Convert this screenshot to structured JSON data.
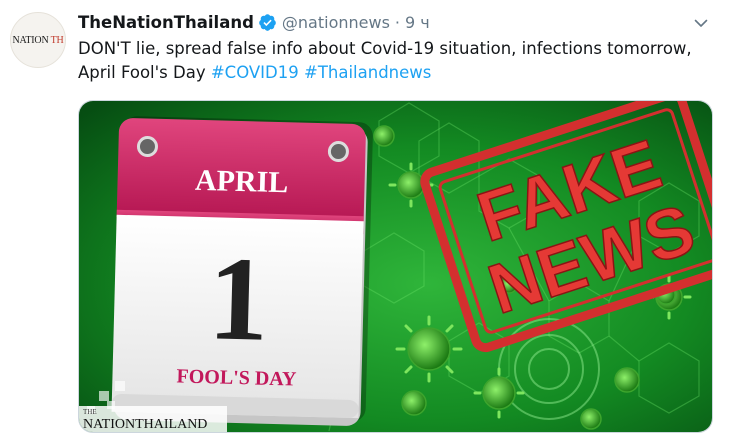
{
  "tweet": {
    "avatar": {
      "brand_main": "NATION",
      "brand_accent": "TH"
    },
    "author": {
      "display_name": "TheNationThailand",
      "handle": "@nationnews",
      "separator": "·",
      "time": "9 ч"
    },
    "text": {
      "body": "DON'T lie, spread false info about Covid-19 situation, infections tomorrow, April Fool's Day",
      "hashtags": [
        "#COVID19",
        "#Thailandnews"
      ]
    },
    "media": {
      "calendar_month": "APRIL",
      "calendar_day": "1",
      "calendar_caption": "FOOL'S DAY",
      "stamp_line1": "FAKE",
      "stamp_line2": "NEWS",
      "watermark_small": "THE",
      "watermark": "NATIONTHAILAND"
    }
  },
  "colors": {
    "link": "#1da1f2",
    "verified": "#1da1f2",
    "stamp_red": "#d32f2f",
    "calendar_magenta": "#c2185b",
    "background_green": "#0f7a1e"
  },
  "icons": [
    "verified-badge-icon",
    "chevron-down-icon"
  ]
}
